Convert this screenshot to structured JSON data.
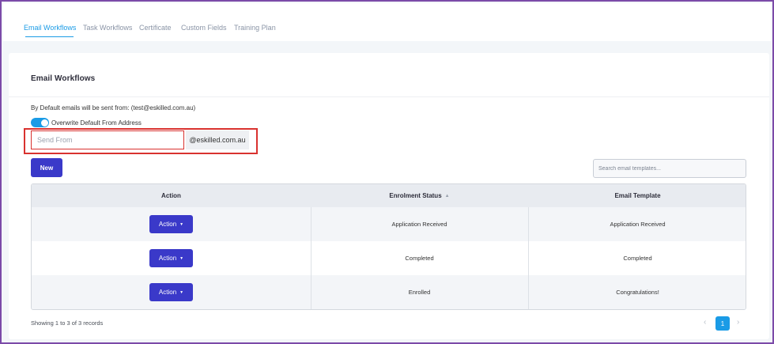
{
  "tabs": [
    {
      "label": "Email Workflows"
    },
    {
      "label": "Task Workflows"
    },
    {
      "label": "Certificate"
    },
    {
      "label": "Custom Fields"
    },
    {
      "label": "Training Plan"
    }
  ],
  "card": {
    "title": "Email Workflows",
    "default_text": "By Default emails will be sent from: (test@eskilled.com.au)",
    "toggle_label": "Overwrite Default From Address",
    "toggle_on": true,
    "send_from_placeholder": "Send From",
    "send_from_value": "",
    "domain_suffix": "@eskilled.com.au",
    "new_label": "New",
    "search_placeholder": "Search email templates..."
  },
  "table": {
    "headers": [
      "Action",
      "Enrolment Status",
      "Email Template"
    ],
    "sort_icon": "sort-asc-icon",
    "rows": [
      {
        "action": "Action",
        "status": "Application Received",
        "template": "Application Received"
      },
      {
        "action": "Action",
        "status": "Completed",
        "template": "Completed"
      },
      {
        "action": "Action",
        "status": "Enrolled",
        "template": "Congratulations!"
      }
    ]
  },
  "footer": {
    "records_text": "Showing 1 to 3 of 3 records",
    "current_page": "1"
  },
  "colors": {
    "accent": "#1a9be6",
    "primary_button": "#3a39c9",
    "highlight": "#d9322f",
    "frame": "#7b4aa8"
  }
}
